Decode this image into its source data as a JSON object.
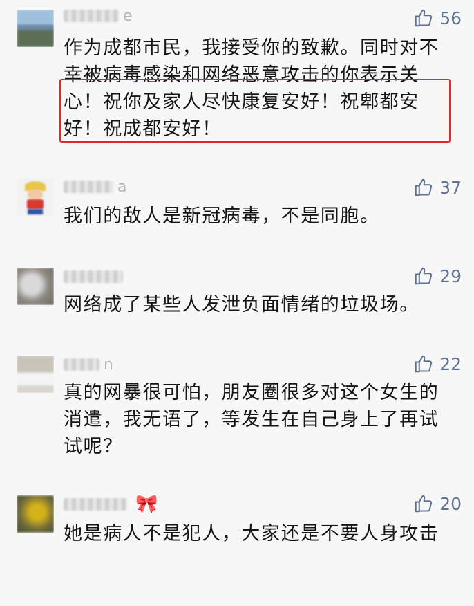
{
  "comments": [
    {
      "name_visible": "e",
      "likes": "56",
      "text": "作为成都市民，我接受你的致歉。同时对不幸被病毒感染和网络恶意攻击的你表示关心！祝你及家人尽快康复安好！祝郫都安好！祝成都安好！"
    },
    {
      "name_visible": "a",
      "likes": "37",
      "text": "我们的敌人是新冠病毒，不是同胞。"
    },
    {
      "name_visible": "",
      "likes": "29",
      "text": "网络成了某些人发泄负面情绪的垃圾场。"
    },
    {
      "name_visible": "n",
      "likes": "22",
      "text": "真的网暴很可怕，朋友圈很多对这个女生的消遣，我无语了，等发生在自己身上了再试试呢？"
    },
    {
      "name_visible": "",
      "name_emoji": "🎀",
      "likes": "20",
      "text": "她是病人不是犯人，大家还是不要人身攻击"
    }
  ],
  "colors": {
    "like": "#5f7191",
    "highlight": "#e32626",
    "name": "#b6b6b6"
  },
  "icons": {
    "like": "thumbs-up-icon"
  }
}
